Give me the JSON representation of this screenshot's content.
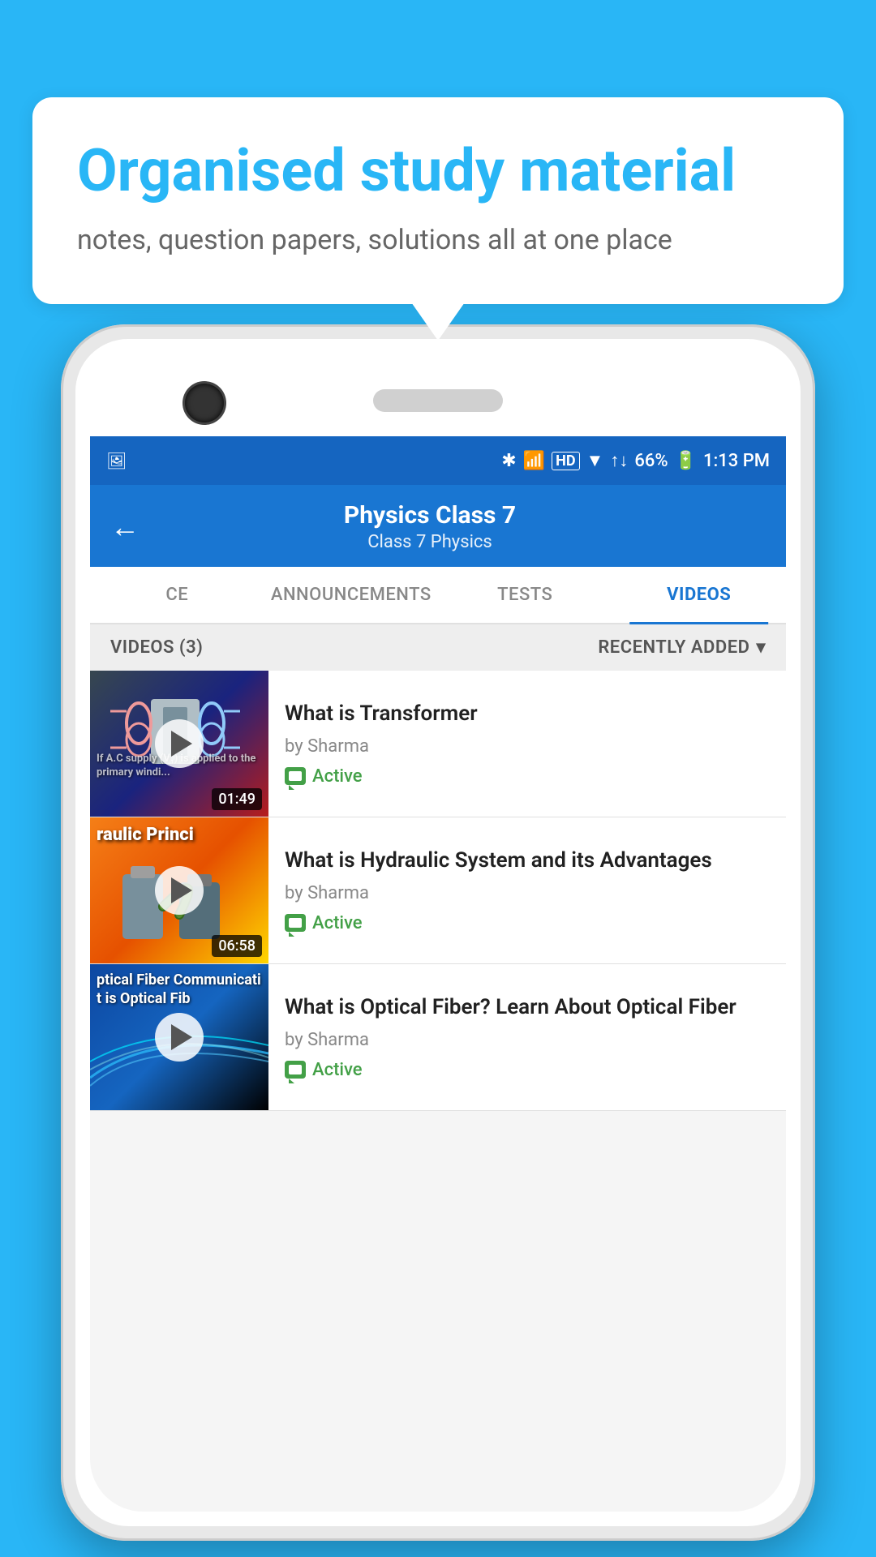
{
  "background": {
    "color": "#29b6f6"
  },
  "speech_bubble": {
    "title": "Organised study material",
    "subtitle": "notes, question papers, solutions all at one place"
  },
  "status_bar": {
    "battery": "66%",
    "time": "1:13 PM",
    "signal_icon": "📶",
    "wifi_icon": "▼"
  },
  "app_header": {
    "back_label": "←",
    "title": "Physics Class 7",
    "subtitle": "Class 7   Physics"
  },
  "tabs": [
    {
      "id": "ce",
      "label": "CE",
      "active": false
    },
    {
      "id": "announcements",
      "label": "ANNOUNCEMENTS",
      "active": false
    },
    {
      "id": "tests",
      "label": "TESTS",
      "active": false
    },
    {
      "id": "videos",
      "label": "VIDEOS",
      "active": true
    }
  ],
  "list_header": {
    "count_label": "VIDEOS (3)",
    "sort_label": "RECENTLY ADDED",
    "sort_icon": "▾"
  },
  "videos": [
    {
      "id": 1,
      "title": "What is  Transformer",
      "author": "by Sharma",
      "status": "Active",
      "duration": "01:49",
      "thumbnail_text": "If A.C supply (V₁) is applied to the primary windi...",
      "thumbnail_type": "1"
    },
    {
      "id": 2,
      "title": "What is Hydraulic System and its Advantages",
      "author": "by Sharma",
      "status": "Active",
      "duration": "06:58",
      "thumbnail_text": "raulic Princi",
      "thumbnail_type": "2"
    },
    {
      "id": 3,
      "title": "What is Optical Fiber? Learn About Optical Fiber",
      "author": "by Sharma",
      "status": "Active",
      "duration": "",
      "thumbnail_text": "ptical Fiber Communicati\nt is Optical Fib",
      "thumbnail_type": "3"
    }
  ]
}
